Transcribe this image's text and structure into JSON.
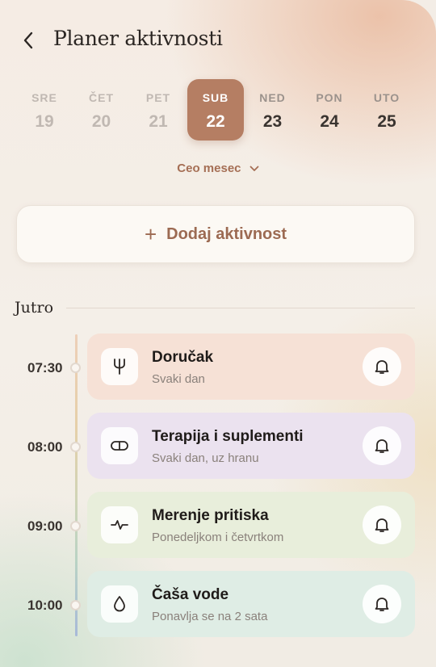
{
  "header": {
    "title": "Planer aktivnosti"
  },
  "week": [
    {
      "name": "SRE",
      "date": "19",
      "state": "past"
    },
    {
      "name": "ČET",
      "date": "20",
      "state": "past"
    },
    {
      "name": "PET",
      "date": "21",
      "state": "past"
    },
    {
      "name": "SUB",
      "date": "22",
      "state": "selected"
    },
    {
      "name": "NED",
      "date": "23",
      "state": "future"
    },
    {
      "name": "PON",
      "date": "24",
      "state": "future"
    },
    {
      "name": "UTO",
      "date": "25",
      "state": "future"
    }
  ],
  "month_toggle": {
    "label": "Ceo mesec"
  },
  "add_button": {
    "icon": "+",
    "label": "Dodaj aktivnost"
  },
  "section": {
    "title": "Jutro"
  },
  "activities": [
    {
      "time": "07:30",
      "title": "Doručak",
      "subtitle": "Svaki dan",
      "icon": "fork-icon",
      "color": "#f6e1d6"
    },
    {
      "time": "08:00",
      "title": "Terapija i suplementi",
      "subtitle": "Svaki dan, uz hranu",
      "icon": "pill-icon",
      "color": "#ebe2ef"
    },
    {
      "time": "09:00",
      "title": "Merenje pritiska",
      "subtitle": "Ponedeljkom i četvrtkom",
      "icon": "pulse-icon",
      "color": "#e8eedb"
    },
    {
      "time": "10:00",
      "title": "Čaša vode",
      "subtitle": "Ponavlja se na 2 sata",
      "icon": "droplet-icon",
      "color": "#dfede5"
    }
  ],
  "colors": {
    "accent": "#b57e63",
    "accent_text": "#a56f55"
  }
}
